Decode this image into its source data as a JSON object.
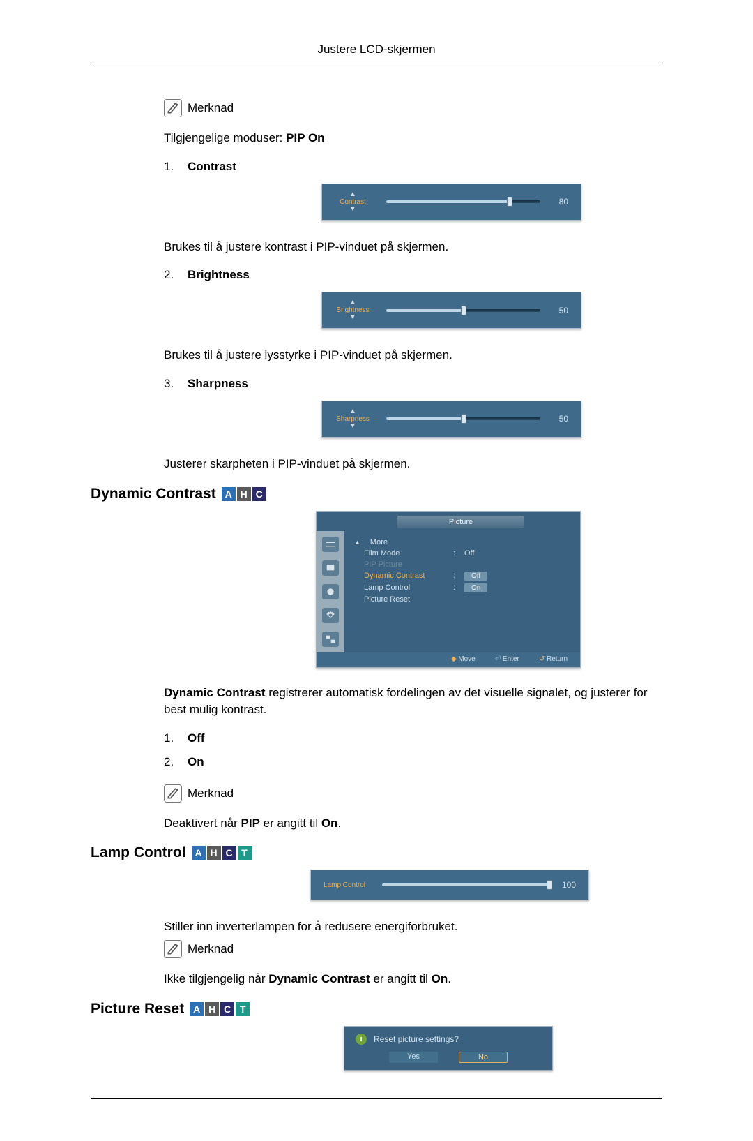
{
  "header": {
    "title": "Justere LCD-skjermen"
  },
  "note_label": "Merknad",
  "intro": {
    "text_prefix": "Tilgjengelige moduser: ",
    "text_bold": "PIP On"
  },
  "items": {
    "contrast": {
      "num": "1.",
      "label": "Contrast",
      "slider": {
        "name": "Contrast",
        "value": "80",
        "percent": 80
      },
      "desc": "Brukes til å justere kontrast i PIP-vinduet på skjermen."
    },
    "brightness": {
      "num": "2.",
      "label": "Brightness",
      "slider": {
        "name": "Brightness",
        "value": "50",
        "percent": 50
      },
      "desc": "Brukes til å justere lysstyrke i PIP-vinduet på skjermen."
    },
    "sharpness": {
      "num": "3.",
      "label": "Sharpness",
      "slider": {
        "name": "Sharpness",
        "value": "50",
        "percent": 50
      },
      "desc": "Justerer skarpheten i PIP-vinduet på skjermen."
    }
  },
  "dynamic_contrast": {
    "heading": "Dynamic Contrast",
    "tags": [
      "A",
      "H",
      "C"
    ],
    "osd": {
      "tab": "Picture",
      "rows": {
        "more": "More",
        "film_mode": {
          "label": "Film Mode",
          "value": "Off"
        },
        "pip_picture": "PIP Picture",
        "dynamic_contrast": {
          "label": "Dynamic Contrast",
          "value": "Off"
        },
        "lamp_control": {
          "label": "Lamp Control",
          "value": "On"
        },
        "picture_reset": "Picture Reset"
      },
      "footer": {
        "move": "Move",
        "enter": "Enter",
        "return": "Return"
      }
    },
    "desc_bold": "Dynamic Contrast",
    "desc_rest": " registrerer automatisk fordelingen av det visuelle signalet, og justerer for best mulig kontrast.",
    "options": {
      "off_num": "1.",
      "off": "Off",
      "on_num": "2.",
      "on": "On"
    },
    "note_text_pre": "Deaktivert når ",
    "note_text_bold1": "PIP",
    "note_text_mid": " er angitt til ",
    "note_text_bold2": "On",
    "note_text_end": "."
  },
  "lamp_control": {
    "heading": "Lamp Control",
    "tags": [
      "A",
      "H",
      "C",
      "T"
    ],
    "slider": {
      "name": "Lamp Control",
      "value": "100",
      "percent": 100
    },
    "desc": "Stiller inn inverterlampen for å redusere energiforbruket.",
    "note_text_pre": "Ikke tilgjengelig når ",
    "note_text_bold1": "Dynamic Contrast",
    "note_text_mid": " er angitt til ",
    "note_text_bold2": "On",
    "note_text_end": "."
  },
  "picture_reset": {
    "heading": "Picture Reset",
    "tags": [
      "A",
      "H",
      "C",
      "T"
    ],
    "dialog": {
      "title": "Reset picture settings?",
      "yes": "Yes",
      "no": "No"
    }
  }
}
